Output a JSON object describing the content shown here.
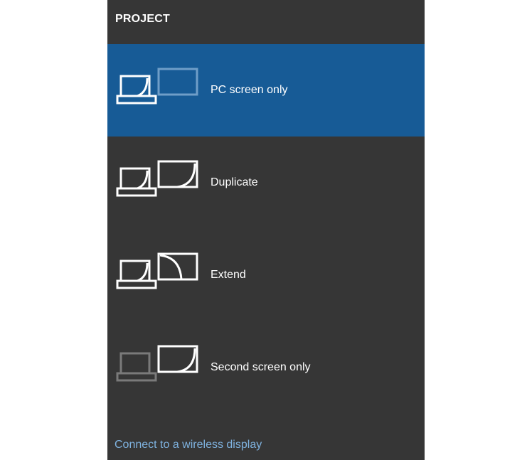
{
  "panel": {
    "title": "PROJECT",
    "options": [
      {
        "label": "PC screen only",
        "icon": "pc-screen-only-icon",
        "selected": true
      },
      {
        "label": "Duplicate",
        "icon": "duplicate-icon",
        "selected": false
      },
      {
        "label": "Extend",
        "icon": "extend-icon",
        "selected": false
      },
      {
        "label": "Second screen only",
        "icon": "second-screen-only-icon",
        "selected": false
      }
    ],
    "connect_link": "Connect to a wireless display"
  },
  "colors": {
    "panel_bg": "#363636",
    "selected_bg": "#175b96",
    "link": "#7fb3e0",
    "page_bg": "#ffffff"
  }
}
